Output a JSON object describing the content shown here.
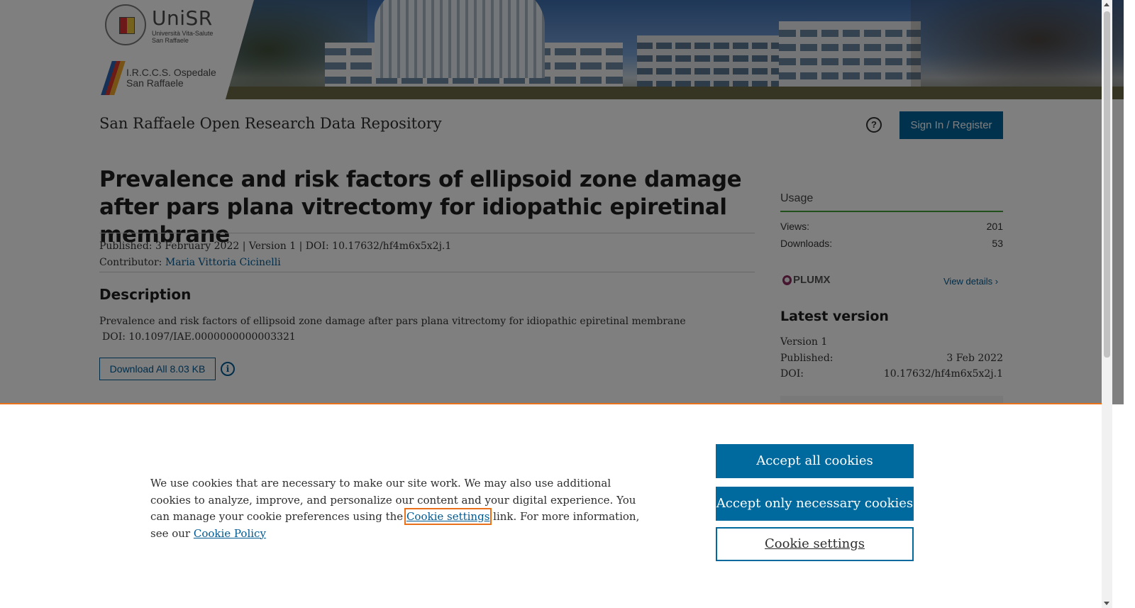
{
  "header": {
    "unisr_name": "UniSR",
    "unisr_sub1": "Università Vita-Salute",
    "unisr_sub2": "San Raffaele",
    "osp_line1": "I.R.C.C.S. Ospedale",
    "osp_line2": "San Raffaele",
    "site_title": "San Raffaele Open Research Data Repository",
    "help_symbol": "?",
    "signin_label": "Sign In / Register"
  },
  "record": {
    "title": "Prevalence and risk factors of ellipsoid zone damage after pars plana vitrectomy for idiopathic epiretinal membrane",
    "published_line": "Published: 3 February 2022 | Version 1 | DOI: 10.17632/hf4m6x5x2j.1",
    "contributor_label": "Contributor:",
    "contributor_name": "Maria Vittoria Cicinelli",
    "description_heading": "Description",
    "description_line1": "Prevalence and risk factors of ellipsoid zone damage after pars plana vitrectomy for idiopathic epiretinal membrane",
    "description_line2": "DOI: 10.1097/IAE.0000000000003321",
    "download_label": "Download All 8.03 KB",
    "info_symbol": "i"
  },
  "sidebar": {
    "usage_heading": "Usage",
    "views_label": "Views:",
    "views_value": "201",
    "downloads_label": "Downloads:",
    "downloads_value": "53",
    "plumx_label": "PLUMX",
    "view_details": "View details",
    "latest_heading": "Latest version",
    "version": "Version 1",
    "published_label": "Published:",
    "published_value": "3 Feb 2022",
    "doi_label": "DOI:",
    "doi_value": "10.17632/hf4m6x5x2j.1"
  },
  "cookie": {
    "text_before": "We use cookies that are necessary to make our site work. We may also use additional cookies to analyze, improve, and personalize our content and your digital experience. You can manage your cookie preferences using the ",
    "settings_link": "Cookie settings",
    "text_middle": " link. For more information, see our ",
    "policy_link": "Cookie Policy",
    "accept_all": "Accept all cookies",
    "accept_necessary": "Accept only necessary cookies",
    "settings_button": "Cookie settings"
  },
  "colors": {
    "accent": "#00629b",
    "usage_rule": "#45a13b",
    "cookie_border": "#e9711c"
  }
}
